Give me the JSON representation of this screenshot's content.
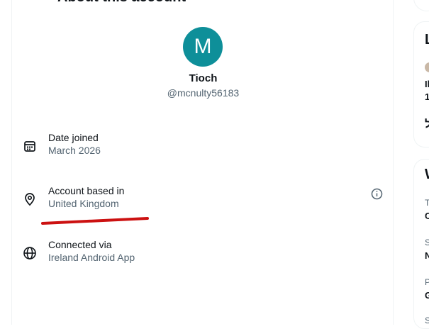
{
  "header": {
    "back_icon": "arrow-left-icon",
    "title": "About this account"
  },
  "profile": {
    "avatar_letter": "M",
    "avatar_color": "#0e8f99",
    "display_name": "Tioch",
    "handle": "@mcnulty56183"
  },
  "details": [
    {
      "icon": "calendar-icon",
      "label": "Date joined",
      "value": "March 2026"
    },
    {
      "icon": "location-pin-icon",
      "label": "Account based in",
      "value": "United Kingdom",
      "info_icon": "info-icon"
    },
    {
      "icon": "globe-icon",
      "label": "Connected via",
      "value": "Ireland Android App"
    }
  ],
  "annotation": {
    "underline_color": "#cc1111"
  },
  "sidebar": {
    "card1": {
      "title_fragment": "L",
      "line1": "Il",
      "line2": "1",
      "line3": "ל"
    },
    "card2": {
      "title_fragment": "W",
      "items": [
        {
          "sub": "T",
          "main": "C"
        },
        {
          "sub": "S",
          "main": "N"
        },
        {
          "sub": "P",
          "main": "G"
        },
        {
          "sub": "S",
          "main": ""
        }
      ]
    }
  }
}
